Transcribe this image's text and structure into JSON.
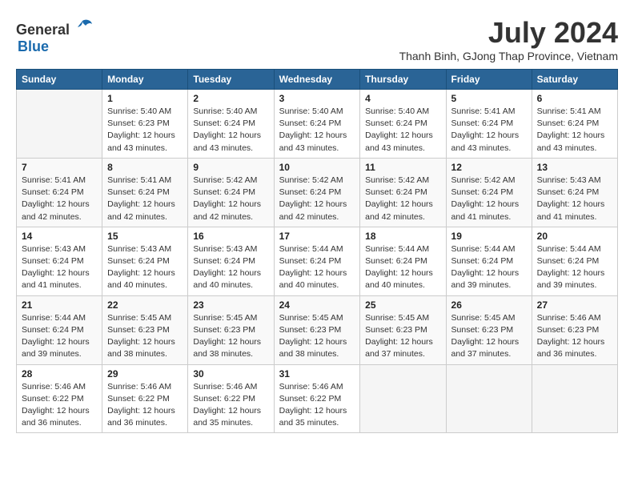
{
  "header": {
    "logo_general": "General",
    "logo_blue": "Blue",
    "month_year": "July 2024",
    "location": "Thanh Binh, GJong Thap Province, Vietnam"
  },
  "columns": [
    "Sunday",
    "Monday",
    "Tuesday",
    "Wednesday",
    "Thursday",
    "Friday",
    "Saturday"
  ],
  "weeks": [
    [
      {
        "day": "",
        "detail": ""
      },
      {
        "day": "1",
        "detail": "Sunrise: 5:40 AM\nSunset: 6:23 PM\nDaylight: 12 hours\nand 43 minutes."
      },
      {
        "day": "2",
        "detail": "Sunrise: 5:40 AM\nSunset: 6:24 PM\nDaylight: 12 hours\nand 43 minutes."
      },
      {
        "day": "3",
        "detail": "Sunrise: 5:40 AM\nSunset: 6:24 PM\nDaylight: 12 hours\nand 43 minutes."
      },
      {
        "day": "4",
        "detail": "Sunrise: 5:40 AM\nSunset: 6:24 PM\nDaylight: 12 hours\nand 43 minutes."
      },
      {
        "day": "5",
        "detail": "Sunrise: 5:41 AM\nSunset: 6:24 PM\nDaylight: 12 hours\nand 43 minutes."
      },
      {
        "day": "6",
        "detail": "Sunrise: 5:41 AM\nSunset: 6:24 PM\nDaylight: 12 hours\nand 43 minutes."
      }
    ],
    [
      {
        "day": "7",
        "detail": "Sunrise: 5:41 AM\nSunset: 6:24 PM\nDaylight: 12 hours\nand 42 minutes."
      },
      {
        "day": "8",
        "detail": "Sunrise: 5:41 AM\nSunset: 6:24 PM\nDaylight: 12 hours\nand 42 minutes."
      },
      {
        "day": "9",
        "detail": "Sunrise: 5:42 AM\nSunset: 6:24 PM\nDaylight: 12 hours\nand 42 minutes."
      },
      {
        "day": "10",
        "detail": "Sunrise: 5:42 AM\nSunset: 6:24 PM\nDaylight: 12 hours\nand 42 minutes."
      },
      {
        "day": "11",
        "detail": "Sunrise: 5:42 AM\nSunset: 6:24 PM\nDaylight: 12 hours\nand 42 minutes."
      },
      {
        "day": "12",
        "detail": "Sunrise: 5:42 AM\nSunset: 6:24 PM\nDaylight: 12 hours\nand 41 minutes."
      },
      {
        "day": "13",
        "detail": "Sunrise: 5:43 AM\nSunset: 6:24 PM\nDaylight: 12 hours\nand 41 minutes."
      }
    ],
    [
      {
        "day": "14",
        "detail": "Sunrise: 5:43 AM\nSunset: 6:24 PM\nDaylight: 12 hours\nand 41 minutes."
      },
      {
        "day": "15",
        "detail": "Sunrise: 5:43 AM\nSunset: 6:24 PM\nDaylight: 12 hours\nand 40 minutes."
      },
      {
        "day": "16",
        "detail": "Sunrise: 5:43 AM\nSunset: 6:24 PM\nDaylight: 12 hours\nand 40 minutes."
      },
      {
        "day": "17",
        "detail": "Sunrise: 5:44 AM\nSunset: 6:24 PM\nDaylight: 12 hours\nand 40 minutes."
      },
      {
        "day": "18",
        "detail": "Sunrise: 5:44 AM\nSunset: 6:24 PM\nDaylight: 12 hours\nand 40 minutes."
      },
      {
        "day": "19",
        "detail": "Sunrise: 5:44 AM\nSunset: 6:24 PM\nDaylight: 12 hours\nand 39 minutes."
      },
      {
        "day": "20",
        "detail": "Sunrise: 5:44 AM\nSunset: 6:24 PM\nDaylight: 12 hours\nand 39 minutes."
      }
    ],
    [
      {
        "day": "21",
        "detail": "Sunrise: 5:44 AM\nSunset: 6:24 PM\nDaylight: 12 hours\nand 39 minutes."
      },
      {
        "day": "22",
        "detail": "Sunrise: 5:45 AM\nSunset: 6:23 PM\nDaylight: 12 hours\nand 38 minutes."
      },
      {
        "day": "23",
        "detail": "Sunrise: 5:45 AM\nSunset: 6:23 PM\nDaylight: 12 hours\nand 38 minutes."
      },
      {
        "day": "24",
        "detail": "Sunrise: 5:45 AM\nSunset: 6:23 PM\nDaylight: 12 hours\nand 38 minutes."
      },
      {
        "day": "25",
        "detail": "Sunrise: 5:45 AM\nSunset: 6:23 PM\nDaylight: 12 hours\nand 37 minutes."
      },
      {
        "day": "26",
        "detail": "Sunrise: 5:45 AM\nSunset: 6:23 PM\nDaylight: 12 hours\nand 37 minutes."
      },
      {
        "day": "27",
        "detail": "Sunrise: 5:46 AM\nSunset: 6:23 PM\nDaylight: 12 hours\nand 36 minutes."
      }
    ],
    [
      {
        "day": "28",
        "detail": "Sunrise: 5:46 AM\nSunset: 6:22 PM\nDaylight: 12 hours\nand 36 minutes."
      },
      {
        "day": "29",
        "detail": "Sunrise: 5:46 AM\nSunset: 6:22 PM\nDaylight: 12 hours\nand 36 minutes."
      },
      {
        "day": "30",
        "detail": "Sunrise: 5:46 AM\nSunset: 6:22 PM\nDaylight: 12 hours\nand 35 minutes."
      },
      {
        "day": "31",
        "detail": "Sunrise: 5:46 AM\nSunset: 6:22 PM\nDaylight: 12 hours\nand 35 minutes."
      },
      {
        "day": "",
        "detail": ""
      },
      {
        "day": "",
        "detail": ""
      },
      {
        "day": "",
        "detail": ""
      }
    ]
  ]
}
